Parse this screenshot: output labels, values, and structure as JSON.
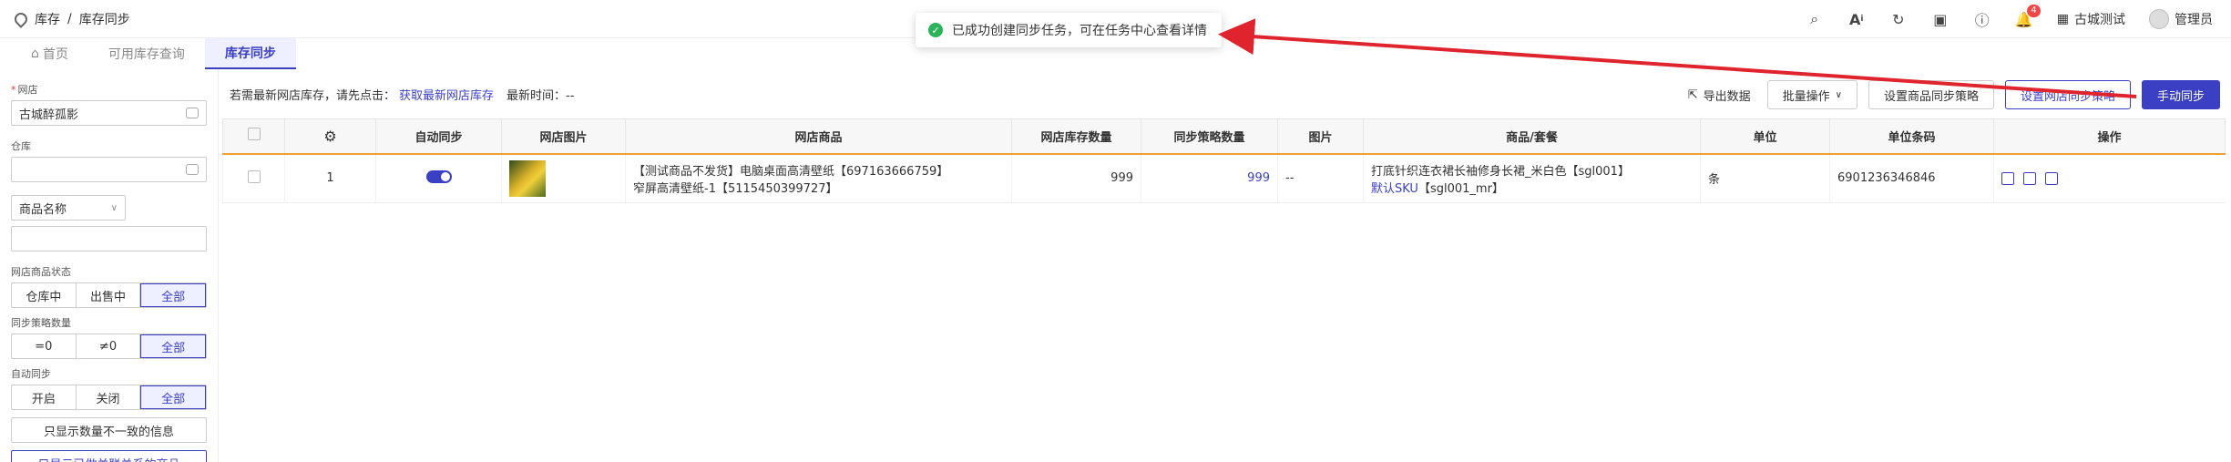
{
  "breadcrumb": {
    "parent": "库存",
    "separator": "/",
    "current": "库存同步"
  },
  "toast": {
    "message": "已成功创建同步任务，可在任务中心查看详情"
  },
  "topbar": {
    "badge_count": "4",
    "store_name": "古城测试",
    "user_name": "管理员"
  },
  "tabs": [
    {
      "label": "首页"
    },
    {
      "label": "可用库存查询"
    },
    {
      "label": "库存同步"
    }
  ],
  "sidebar": {
    "shop_label": "网店",
    "shop_value": "古城醉孤影",
    "warehouse_label": "仓库",
    "warehouse_value": "",
    "product_dropdown": "商品名称",
    "product_input": "",
    "status_label": "网店商品状态",
    "status_options": [
      "仓库中",
      "出售中",
      "全部"
    ],
    "strategy_label": "同步策略数量",
    "strategy_options": [
      "=0",
      "≠0",
      "全部"
    ],
    "auto_label": "自动同步",
    "auto_options": [
      "开启",
      "关闭",
      "全部"
    ],
    "btn_inconsistent": "只显示数量不一致的信息",
    "btn_linked": "只显示已做关联关系的商品"
  },
  "toolbar": {
    "hint": "若需最新网店库存，请先点击：",
    "fetch_link": "获取最新网店库存",
    "time_label": "最新时间：--",
    "export": "导出数据",
    "batch": "批量操作",
    "set_strategy": "设置商品同步策略",
    "set_shop_strategy": "设置网店同步策略",
    "manual_sync": "手动同步"
  },
  "table": {
    "headers": [
      "自动同步",
      "网店图片",
      "网店商品",
      "网店库存数量",
      "同步策略数量",
      "图片",
      "商品/套餐",
      "单位",
      "单位条码",
      "操作"
    ],
    "rows": [
      {
        "index": "1",
        "product_line1": "【测试商品不发货】电脑桌面高清壁纸【697163666759】",
        "product_line2": "窄屏高清壁纸-1【5115450399727】",
        "shop_stock": "999",
        "strategy_stock": "999",
        "image": "--",
        "sku_name": "打底针织连衣裙长袖修身长裙_米白色【sgl001】",
        "sku_default": "默认SKU",
        "sku_code": "【sgl001_mr】",
        "unit": "条",
        "barcode": "6901236346846"
      }
    ]
  }
}
